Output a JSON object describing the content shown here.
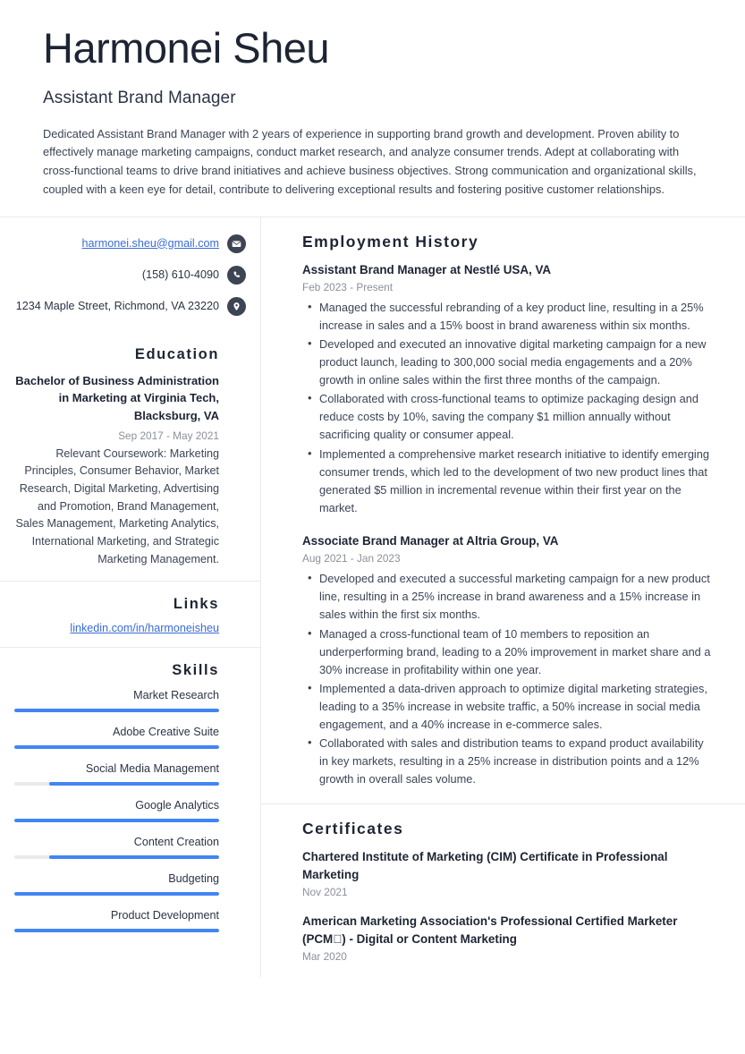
{
  "header": {
    "name": "Harmonei Sheu",
    "job_title": "Assistant Brand Manager",
    "summary": "Dedicated Assistant Brand Manager with 2 years of experience in supporting brand growth and development. Proven ability to effectively manage marketing campaigns, conduct market research, and analyze consumer trends. Adept at collaborating with cross-functional teams to drive brand initiatives and achieve business objectives. Strong communication and organizational skills, coupled with a keen eye for detail, contribute to delivering exceptional results and fostering positive customer relationships."
  },
  "theme": {
    "accent": "#4285f4",
    "link": "#3a6bd6",
    "icon_circle": "#3d4454",
    "text": "#2b3445",
    "muted": "#8b9099",
    "divider": "#e8eaee"
  },
  "contact": {
    "email": "harmonei.sheu@gmail.com",
    "phone": "(158) 610-4090",
    "address": "1234 Maple Street, Richmond, VA 23220",
    "icons": {
      "email": "envelope-icon",
      "phone": "phone-icon",
      "address": "location-pin-icon"
    }
  },
  "education": {
    "heading": "Education",
    "degree": "Bachelor of Business Administration in Marketing at Virginia Tech, Blacksburg, VA",
    "date": "Sep 2017 - May 2021",
    "description": "Relevant Coursework: Marketing Principles, Consumer Behavior, Market Research, Digital Marketing, Advertising and Promotion, Brand Management, Sales Management, Marketing Analytics, International Marketing, and Strategic Marketing Management."
  },
  "links": {
    "heading": "Links",
    "items": [
      {
        "label": "linkedin.com/in/harmoneisheu"
      }
    ]
  },
  "skills": {
    "heading": "Skills",
    "items": [
      {
        "name": "Market Research",
        "level": 100
      },
      {
        "name": "Adobe Creative Suite",
        "level": 100
      },
      {
        "name": "Social Media Management",
        "level": 83
      },
      {
        "name": "Google Analytics",
        "level": 100
      },
      {
        "name": "Content Creation",
        "level": 83
      },
      {
        "name": "Budgeting",
        "level": 100
      },
      {
        "name": "Product Development",
        "level": 100
      }
    ]
  },
  "employment": {
    "heading": "Employment History",
    "entries": [
      {
        "title": "Assistant Brand Manager at Nestlé USA, VA",
        "date": "Feb 2023 - Present",
        "bullets": [
          "Managed the successful rebranding of a key product line, resulting in a 25% increase in sales and a 15% boost in brand awareness within six months.",
          "Developed and executed an innovative digital marketing campaign for a new product launch, leading to 300,000 social media engagements and a 20% growth in online sales within the first three months of the campaign.",
          "Collaborated with cross-functional teams to optimize packaging design and reduce costs by 10%, saving the company $1 million annually without sacrificing quality or consumer appeal.",
          "Implemented a comprehensive market research initiative to identify emerging consumer trends, which led to the development of two new product lines that generated $5 million in incremental revenue within their first year on the market."
        ]
      },
      {
        "title": "Associate Brand Manager at Altria Group, VA",
        "date": "Aug 2021 - Jan 2023",
        "bullets": [
          "Developed and executed a successful marketing campaign for a new product line, resulting in a 25% increase in brand awareness and a 15% increase in sales within the first six months.",
          "Managed a cross-functional team of 10 members to reposition an underperforming brand, leading to a 20% improvement in market share and a 30% increase in profitability within one year.",
          "Implemented a data-driven approach to optimize digital marketing strategies, leading to a 35% increase in website traffic, a 50% increase in social media engagement, and a 40% increase in e-commerce sales.",
          "Collaborated with sales and distribution teams to expand product availability in key markets, resulting in a 25% increase in distribution points and a 12% growth in overall sales volume."
        ]
      }
    ]
  },
  "certificates": {
    "heading": "Certificates",
    "entries": [
      {
        "title": "Chartered Institute of Marketing (CIM) Certificate in Professional Marketing",
        "date": "Nov 2021"
      },
      {
        "title": "American Marketing Association's Professional Certified Marketer (PCM\u0000) - Digital or Content Marketing",
        "date": "Mar 2020"
      }
    ]
  }
}
